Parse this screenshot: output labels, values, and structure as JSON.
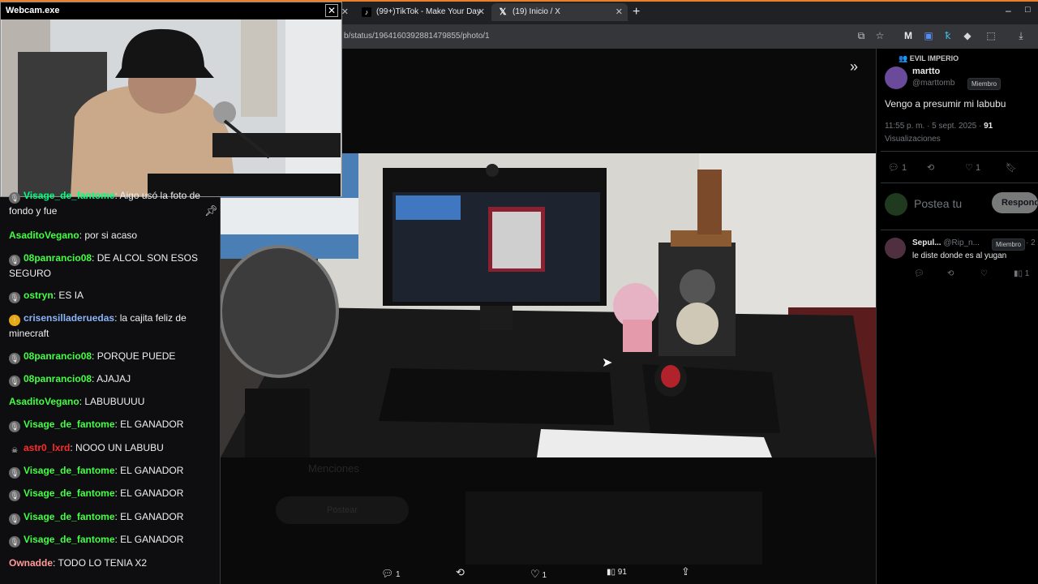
{
  "browser": {
    "tabs": [
      {
        "label": ""
      },
      {
        "label": "(99+)TikTok - Make Your Day"
      },
      {
        "label": "(19) Inicio / X"
      }
    ],
    "new_tab": "+",
    "url": "b/status/1964160392881479855/photo/1",
    "window_controls": {
      "minimize": "–",
      "maximize": "□"
    }
  },
  "webcam": {
    "title": "Webcam.exe",
    "close": "✕"
  },
  "chat": {
    "messages": [
      {
        "user": "Visage_de_fantome",
        "text": "Aigo usó la foto de fondo y fue",
        "color": "#00ff7f",
        "icon": "mic-badge-icon"
      },
      {
        "user": "AsaditoVegano",
        "text": "por si acaso",
        "color": "#43ff43",
        "icon": ""
      },
      {
        "user": "08panrancio08",
        "text": "DE ALCOL SON ESOS SEGURO",
        "color": "#43ff43",
        "icon": "mic-badge-icon"
      },
      {
        "user": "ostryn",
        "text": "ES IA",
        "color": "#43ff43",
        "icon": "mic-badge-icon"
      },
      {
        "user": "crisensilladeruedas",
        "text": "la cajita feliz de minecraft",
        "color": "#8ab4f8",
        "icon": "sub-badge-icon"
      },
      {
        "user": "08panrancio08",
        "text": "PORQUE PUEDE",
        "color": "#43ff43",
        "icon": "mic-badge-icon"
      },
      {
        "user": "08panrancio08",
        "text": "AJAJAJ",
        "color": "#43ff43",
        "icon": "mic-badge-icon"
      },
      {
        "user": "AsaditoVegano",
        "text": "LABUBUUUU",
        "color": "#43ff43",
        "icon": ""
      },
      {
        "user": "Visage_de_fantome",
        "text": "EL GANADOR",
        "color": "#43ff43",
        "icon": "mic-badge-icon"
      },
      {
        "user": "astr0_lxrd",
        "text": "NOOO UN LABUBU",
        "color": "#ff2a2a",
        "icon": "skull-badge-icon"
      },
      {
        "user": "Visage_de_fantome",
        "text": "EL GANADOR",
        "color": "#43ff43",
        "icon": "mic-badge-icon"
      },
      {
        "user": "Visage_de_fantome",
        "text": "EL GANADOR",
        "color": "#43ff43",
        "icon": "mic-badge-icon"
      },
      {
        "user": "Visage_de_fantome",
        "text": "EL GANADOR",
        "color": "#43ff43",
        "icon": "mic-badge-icon"
      },
      {
        "user": "Visage_de_fantome",
        "text": "EL GANADOR",
        "color": "#43ff43",
        "icon": "mic-badge-icon"
      },
      {
        "user": "Ownadde",
        "text": "TODO LO TENIA X2",
        "color": "#ff9a9a",
        "icon": ""
      }
    ]
  },
  "tweet": {
    "community": "EVIL IMPERIO",
    "author_name": "martto",
    "author_handle": "@marttomb",
    "badge": "Miembro",
    "text": "Vengo a presumir mi labubu",
    "time": "11:55 p. m. · 5 sept. 2025 ·",
    "views_count": "91",
    "views_label": "Visualizaciones",
    "replies": "1",
    "likes": "1",
    "compose_placeholder": "Postea tu",
    "reply_button": "Respond"
  },
  "reply": {
    "name": "Sepul...",
    "handle": "@Rip_n...",
    "badge": "Miembro",
    "extra": "· 2",
    "text": "le diste donde es al yugan",
    "views": "1"
  },
  "media_bar": {
    "replies": "1",
    "likes": "1",
    "views": "91"
  },
  "background_page": {
    "mentions": "Menciones",
    "post_button": "Postear"
  },
  "colors": {
    "x_bg": "#000000",
    "chat_bg": "#0e0e10",
    "accent_orange": "#e9812a"
  }
}
